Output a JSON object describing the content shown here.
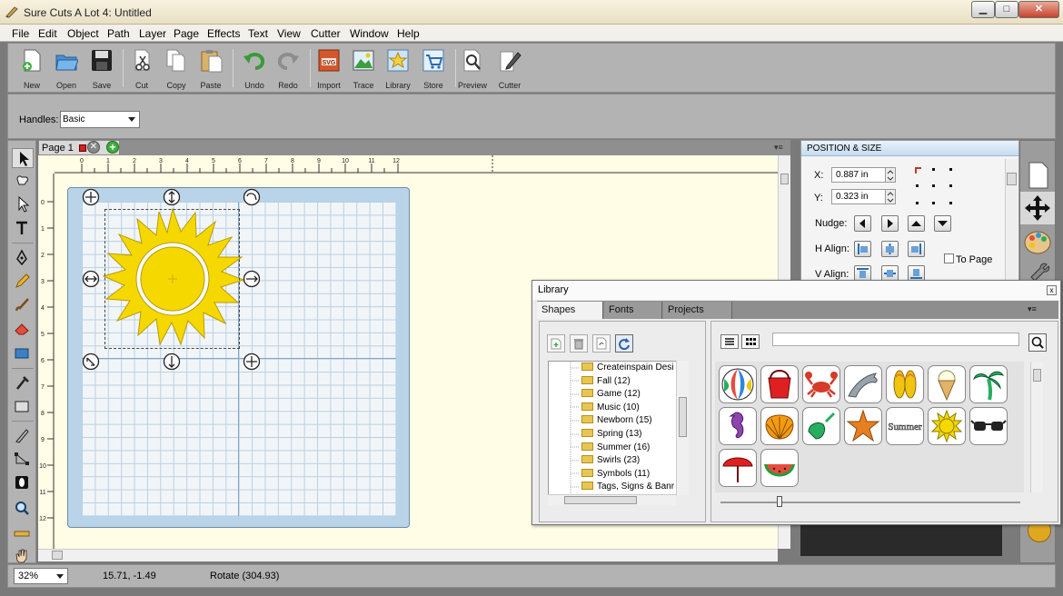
{
  "window": {
    "title": "Sure Cuts A Lot 4: Untitled",
    "minimize": "▁",
    "maximize": "□",
    "close": "✕"
  },
  "menu": [
    "File",
    "Edit",
    "Object",
    "Path",
    "Layer",
    "Page",
    "Effects",
    "Text",
    "View",
    "Cutter",
    "Window",
    "Help"
  ],
  "toolbar": {
    "new": "New",
    "open": "Open",
    "save": "Save",
    "cut": "Cut",
    "copy": "Copy",
    "paste": "Paste",
    "undo": "Undo",
    "redo": "Redo",
    "import": "Import",
    "import_badge": "SVG",
    "trace": "Trace",
    "library": "Library",
    "store": "Store",
    "preview": "Preview",
    "cutter": "Cutter"
  },
  "handles": {
    "label": "Handles:",
    "value": "Basic"
  },
  "page_tab": {
    "label": "Page 1"
  },
  "ruler": {
    "top": [
      "0",
      "1",
      "2",
      "3",
      "4",
      "5",
      "6",
      "7",
      "8",
      "9",
      "10",
      "11",
      "12"
    ],
    "left": [
      "0",
      "1",
      "2",
      "3",
      "4",
      "5",
      "6",
      "7",
      "8",
      "9",
      "10",
      "11",
      "12"
    ]
  },
  "position_size": {
    "title": "POSITION & SIZE",
    "x_label": "X:",
    "x_value": "0.887 in",
    "y_label": "Y:",
    "y_value": "0.323 in",
    "nudge_label": "Nudge:",
    "halign_label": "H Align:",
    "valign_label": "V Align:",
    "to_page": "To Page"
  },
  "library": {
    "title": "Library",
    "tabs": [
      "Shapes",
      "Fonts",
      "Projects"
    ],
    "tree": [
      "Createinspain Desi",
      "Fall (12)",
      "Game (12)",
      "Music (10)",
      "Newborn (15)",
      "Spring (13)",
      "Summer (16)",
      "Swirls (23)",
      "Symbols (11)",
      "Tags, Signs & Banr"
    ],
    "search_value": "",
    "shapes": [
      "beach-ball",
      "bucket",
      "crab",
      "dolphin",
      "flip-flops",
      "ice-cream",
      "palm-tree",
      "seahorse",
      "shell",
      "shovel",
      "starfish",
      "summer-text",
      "sun",
      "sunglasses",
      "umbrella",
      "watermelon"
    ],
    "summer_text": "Summer"
  },
  "status": {
    "zoom": "32%",
    "coords": "15.71, -1.49",
    "action": "Rotate (304.93)"
  },
  "colors": {
    "sun": "#f5d800",
    "sun_edge": "#b89a00",
    "mat": "#b9d4e8",
    "panel": "#b3b3b3",
    "canvas_bg": "#fffde6"
  }
}
